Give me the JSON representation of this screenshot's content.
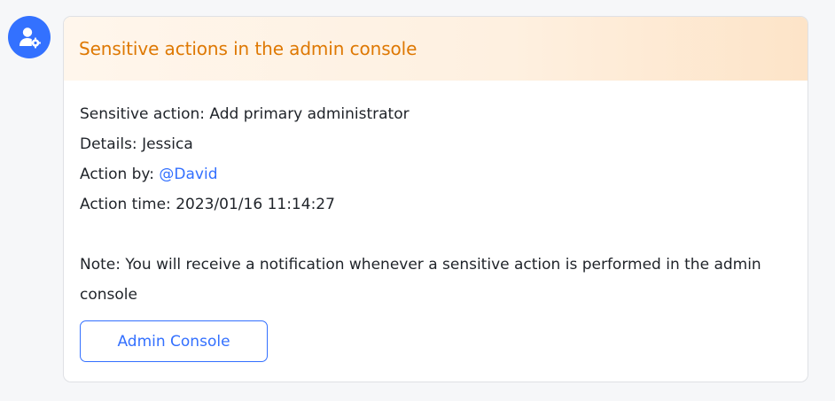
{
  "avatar": {
    "icon": "admin-user-gear-icon",
    "color": "#3371ff"
  },
  "card": {
    "title": "Sensitive actions in the admin console",
    "title_color": "#de7802",
    "action": {
      "label": "Sensitive action: ",
      "value": "Add primary administrator"
    },
    "details": {
      "label": "Details: ",
      "value": "Jessica"
    },
    "action_by": {
      "label": "Action by: ",
      "value": "@David"
    },
    "action_time": {
      "label": "Action time: ",
      "value": "2023/01/16 11:14:27"
    },
    "note": "Note: You will receive a notification whenever a sensitive action is performed in the admin console",
    "button_label": "Admin Console",
    "accent_color": "#3370ff"
  }
}
